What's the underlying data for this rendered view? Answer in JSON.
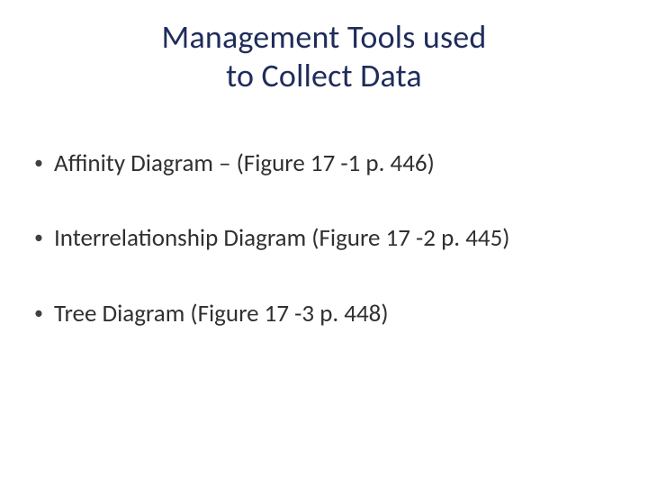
{
  "title_line1": "Management Tools used",
  "title_line2": "to Collect Data",
  "bullets": [
    {
      "text": "Affinity Diagram – (Figure 17 -1 p. 446)"
    },
    {
      "text": "Interrelationship Diagram (Figure 17 -2 p. 445)"
    },
    {
      "text": "Tree Diagram (Figure 17 -3 p. 448)"
    }
  ]
}
